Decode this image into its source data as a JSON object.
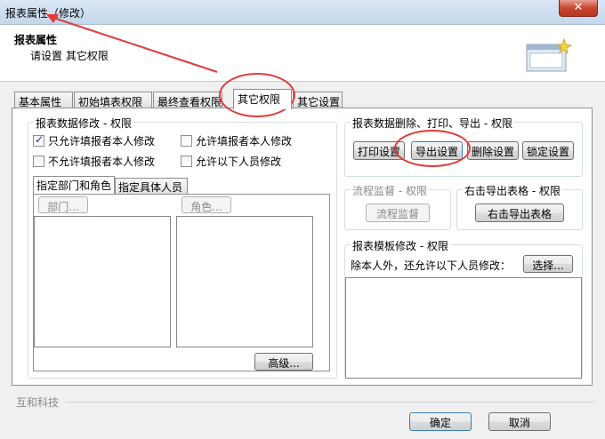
{
  "window": {
    "title": "报表属性（修改）",
    "close_glyph": "✕"
  },
  "header": {
    "title": "报表属性",
    "subtitle": "请设置 其它权限"
  },
  "tabs": [
    {
      "label": "基本属性"
    },
    {
      "label": "初始填表权限"
    },
    {
      "label": "最终查看权限"
    },
    {
      "label": "其它权限"
    },
    {
      "label": "其它设置"
    }
  ],
  "data_modify": {
    "legend": "报表数据修改 - 权限",
    "options": [
      {
        "label": "只允许填报者本人修改",
        "checked": true
      },
      {
        "label": "允许填报者本人修改",
        "checked": false
      },
      {
        "label": "不允许填报者本人修改",
        "checked": false
      },
      {
        "label": "允许以下人员修改",
        "checked": false
      }
    ],
    "subtabs": [
      {
        "label": "指定部门和角色"
      },
      {
        "label": "指定具体人员"
      }
    ],
    "dept_button": "部门...",
    "role_button": "角色...",
    "advanced_button": "高级..."
  },
  "delete_print_export": {
    "legend": "报表数据删除、打印、导出 - 权限",
    "buttons": [
      "打印设置",
      "导出设置",
      "删除设置",
      "锁定设置"
    ]
  },
  "workflow": {
    "legend": "流程监督 - 权限",
    "button": "流程监督"
  },
  "right_export": {
    "legend": "右击导出表格 - 权限",
    "button": "右击导出表格"
  },
  "template_modify": {
    "legend": "报表模板修改 - 权限",
    "desc": "除本人外，还允许以下人员修改：",
    "button": "选择..."
  },
  "footer": {
    "company": "互和科技",
    "ok": "确定",
    "cancel": "取消"
  }
}
